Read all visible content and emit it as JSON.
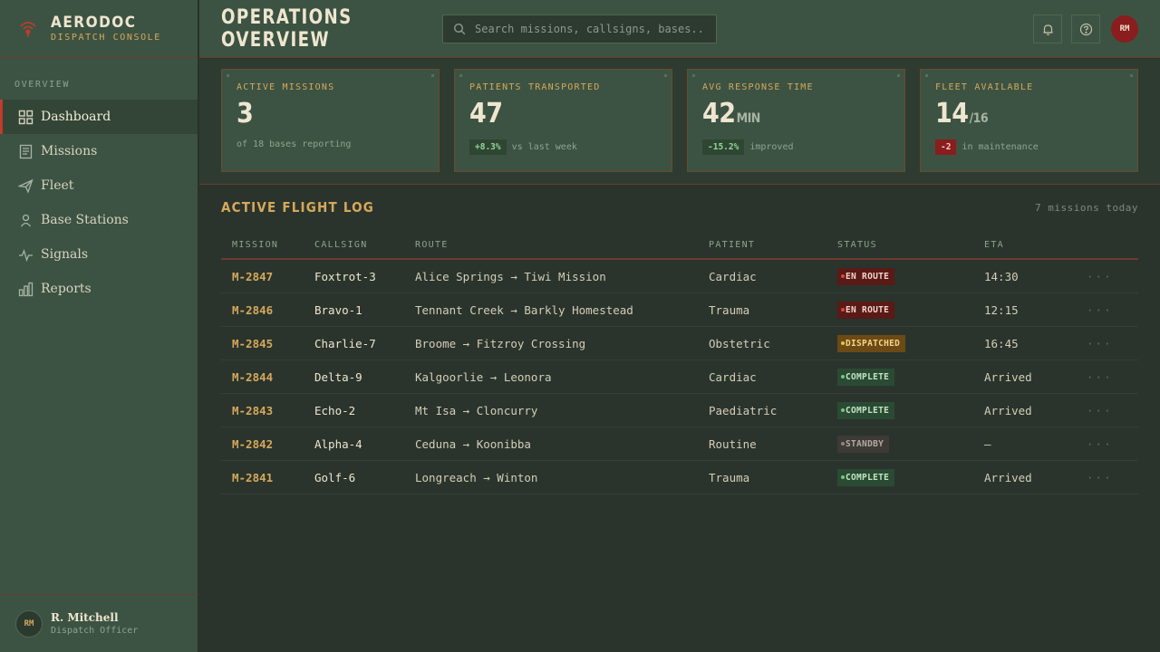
{
  "brand": {
    "title": "AERODOC",
    "subtitle": "DISPATCH CONSOLE"
  },
  "sidebar": {
    "section": "OVERVIEW",
    "items": [
      {
        "label": "Dashboard",
        "icon": "grid-icon",
        "active": true
      },
      {
        "label": "Missions",
        "icon": "document-icon"
      },
      {
        "label": "Fleet",
        "icon": "plane-icon"
      },
      {
        "label": "Base Stations",
        "icon": "person-pin-icon"
      },
      {
        "label": "Signals",
        "icon": "pulse-icon"
      },
      {
        "label": "Reports",
        "icon": "bar-chart-icon"
      }
    ],
    "user": {
      "initials": "RM",
      "name": "R. Mitchell",
      "role": "Dispatch Officer"
    }
  },
  "header": {
    "title": "OPERATIONS OVERVIEW",
    "search_placeholder": "Search missions, callsigns, bases...",
    "avatar_initials": "RM"
  },
  "stats": [
    {
      "label": "ACTIVE MISSIONS",
      "value": "3",
      "unit": "",
      "badge": "",
      "note": "of 18 bases reporting"
    },
    {
      "label": "PATIENTS TRANSPORTED",
      "value": "47",
      "unit": "",
      "badge": "+8.3%",
      "note": "vs last week"
    },
    {
      "label": "AVG RESPONSE TIME",
      "value": "42",
      "unit": "MIN",
      "badge": "-15.2%",
      "note": "improved"
    },
    {
      "label": "FLEET AVAILABLE",
      "value": "14",
      "unit": "/16",
      "badge": "-2",
      "note": "in maintenance"
    }
  ],
  "log": {
    "title": "ACTIVE FLIGHT LOG",
    "count": "7 missions today",
    "columns": [
      "MISSION",
      "CALLSIGN",
      "ROUTE",
      "PATIENT",
      "STATUS",
      "ETA"
    ],
    "rows": [
      {
        "mission": "M-2847",
        "callsign": "Foxtrot-3",
        "route": "Alice Springs → Tiwi Mission",
        "patient": "Cardiac",
        "status": "EN ROUTE",
        "eta": "14:30"
      },
      {
        "mission": "M-2846",
        "callsign": "Bravo-1",
        "route": "Tennant Creek → Barkly Homestead",
        "patient": "Trauma",
        "status": "EN ROUTE",
        "eta": "12:15"
      },
      {
        "mission": "M-2845",
        "callsign": "Charlie-7",
        "route": "Broome → Fitzroy Crossing",
        "patient": "Obstetric",
        "status": "DISPATCHED",
        "eta": "16:45"
      },
      {
        "mission": "M-2844",
        "callsign": "Delta-9",
        "route": "Kalgoorlie → Leonora",
        "patient": "Cardiac",
        "status": "COMPLETE",
        "eta": "Arrived"
      },
      {
        "mission": "M-2843",
        "callsign": "Echo-2",
        "route": "Mt Isa → Cloncurry",
        "patient": "Paediatric",
        "status": "COMPLETE",
        "eta": "Arrived"
      },
      {
        "mission": "M-2842",
        "callsign": "Alpha-4",
        "route": "Ceduna → Koonibba",
        "patient": "Routine",
        "status": "STANDBY",
        "eta": "—"
      },
      {
        "mission": "M-2841",
        "callsign": "Golf-6",
        "route": "Longreach → Winton",
        "patient": "Trauma",
        "status": "COMPLETE",
        "eta": "Arrived"
      }
    ],
    "more_label": "···"
  },
  "colors": {
    "accent_red": "#c23b2d",
    "accent_gold": "#d6a85a",
    "panel": "#3c5343",
    "background": "#2a342c"
  }
}
